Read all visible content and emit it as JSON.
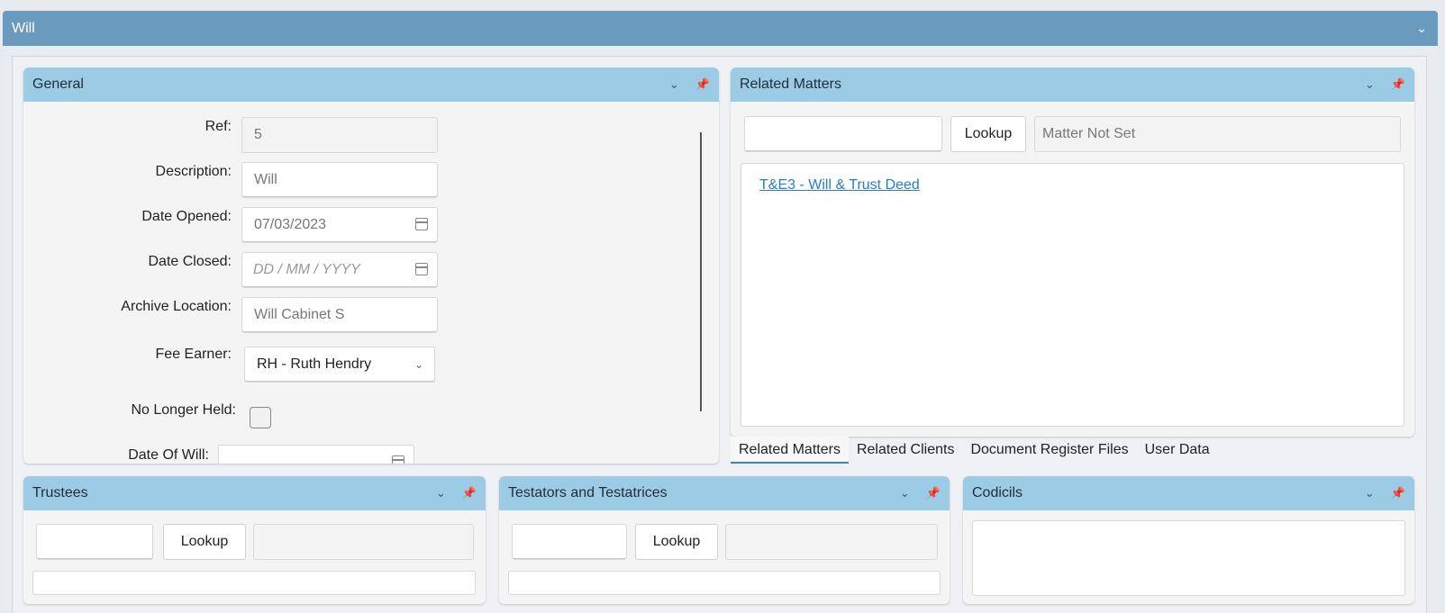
{
  "window": {
    "title": "Will"
  },
  "general": {
    "title": "General",
    "fields": {
      "ref_label": "Ref:",
      "ref_value": "5",
      "description_label": "Description:",
      "description_value": "Will",
      "date_opened_label": "Date Opened:",
      "date_opened_value": "07/03/2023",
      "date_closed_label": "Date Closed:",
      "date_closed_placeholder": "DD / MM / YYYY",
      "archive_label": "Archive Location:",
      "archive_value": "Will Cabinet S",
      "fee_earner_label": "Fee Earner:",
      "fee_earner_value": "RH  - Ruth Hendry",
      "no_longer_held_label": "No Longer Held:",
      "date_of_will_label": "Date Of Will:"
    }
  },
  "related_matters": {
    "title": "Related Matters",
    "lookup_label": "Lookup",
    "matter_status": "Matter Not Set",
    "items": [
      "T&E3 - Will & Trust Deed"
    ],
    "tabs": [
      "Related Matters",
      "Related Clients",
      "Document Register Files",
      "User Data"
    ]
  },
  "trustees": {
    "title": "Trustees",
    "lookup_label": "Lookup"
  },
  "testators": {
    "title": "Testators and Testatrices",
    "lookup_label": "Lookup"
  },
  "codicils": {
    "title": "Codicils"
  },
  "icons": {
    "collapse": "chevron-down-icon",
    "pin": "pin-icon",
    "calendar": "calendar-icon"
  }
}
